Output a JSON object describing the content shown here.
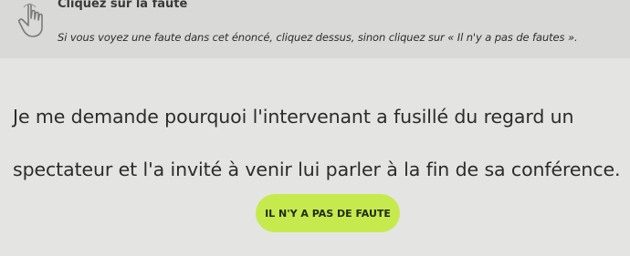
{
  "header": {
    "icon": "hand-pointer-icon",
    "title": "Cliquez sur la faute",
    "instruction": "Si vous voyez une faute dans cet énoncé, cliquez dessus, sinon cliquez sur « Il n'y a pas de fautes »."
  },
  "exercise": {
    "line1": "Je me demande pourquoi l'intervenant a fusillé du regard un",
    "line2": "spectateur et l'a invité à venir lui parler à la fin de sa conférence."
  },
  "actions": {
    "no_error_label": "IL N'Y A PAS DE FAUTE"
  },
  "colors": {
    "accent": "#c6ea4e",
    "background": "#e4e4e2"
  }
}
